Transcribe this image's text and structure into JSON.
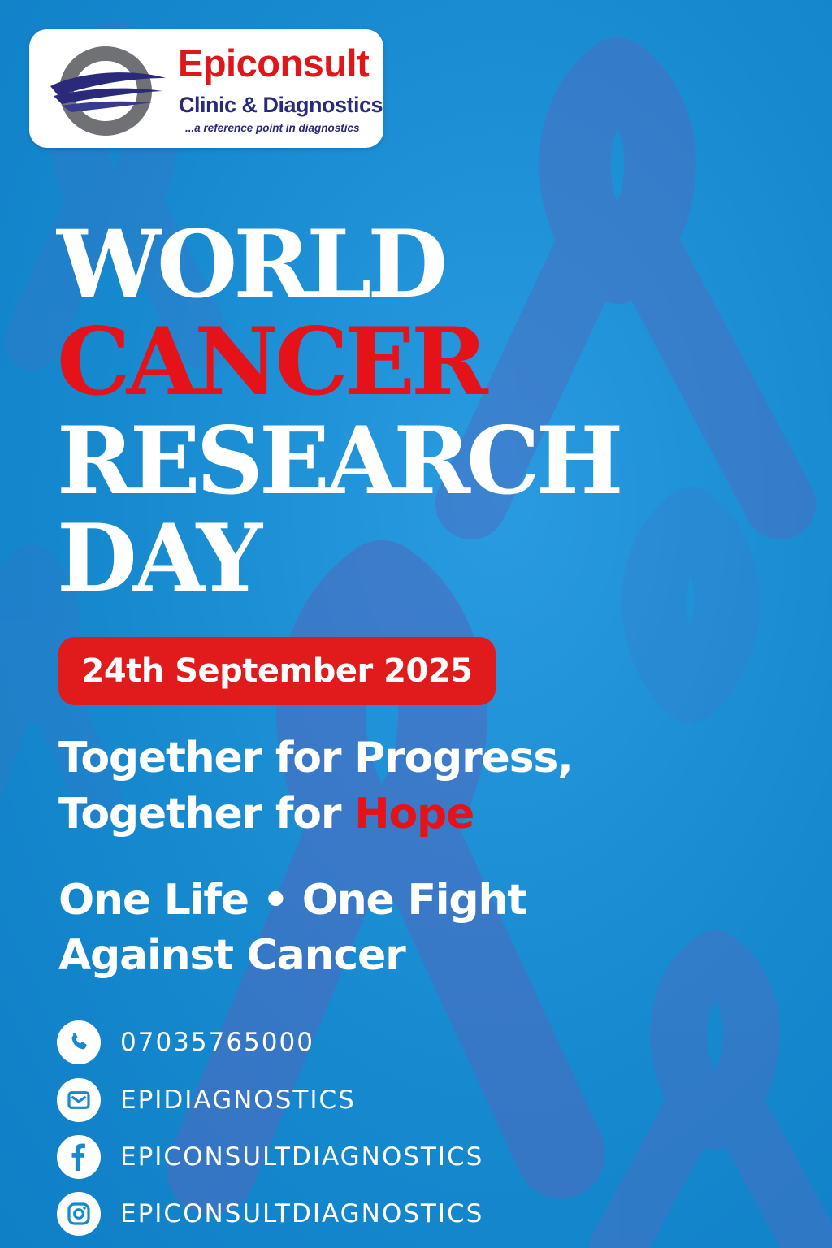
{
  "brand": {
    "name": "Epiconsult",
    "subtitle": "Clinic & Diagnostics",
    "tagline": "...a reference point in diagnostics",
    "colors": {
      "red": "#e0161b",
      "navy": "#2b2a7a",
      "gray": "#6d6e71"
    }
  },
  "headline": {
    "line1": "WORLD",
    "line2": "CANCER",
    "line3": "RESEARCH",
    "line4": "DAY"
  },
  "date": "24th September 2025",
  "slogan": {
    "line1": "Together for Progress,",
    "line2_prefix": "Together for ",
    "line2_highlight": "Hope",
    "line3": "One Life • One Fight",
    "line4": "Against Cancer"
  },
  "contacts": [
    {
      "icon": "phone-icon",
      "text": "07035765000"
    },
    {
      "icon": "email-icon",
      "text": "EPIDIAGNOSTICS"
    },
    {
      "icon": "facebook-icon",
      "text": "EPICONSULTDIAGNOSTICS"
    },
    {
      "icon": "instagram-icon",
      "text": "EPICONSULTDIAGNOSTICS"
    }
  ],
  "colors": {
    "background": "#1b8fd4",
    "ribbon": "#4a72c4",
    "accent_red": "#e11b1b",
    "text_white": "#ffffff"
  }
}
